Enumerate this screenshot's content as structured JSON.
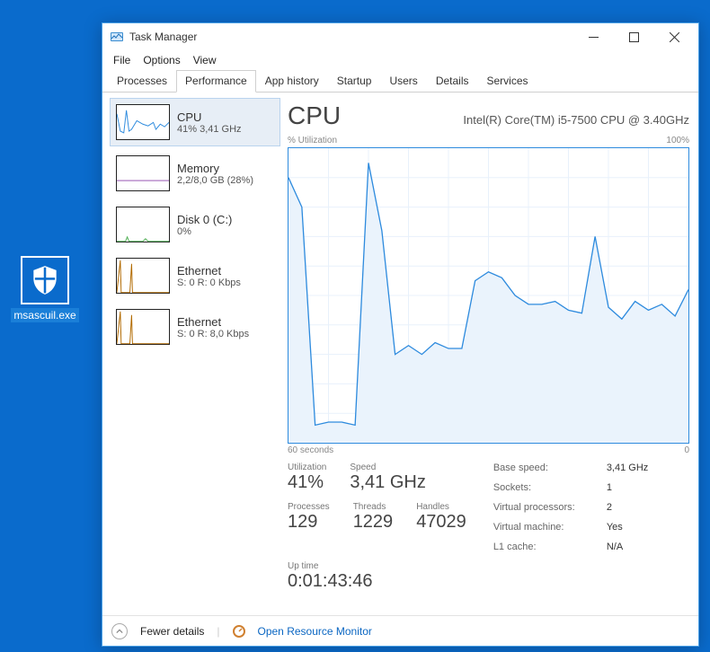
{
  "desktop_icon": {
    "label": "msascuil.exe"
  },
  "window": {
    "title": "Task Manager",
    "menus": [
      "File",
      "Options",
      "View"
    ],
    "tabs": [
      "Processes",
      "Performance",
      "App history",
      "Startup",
      "Users",
      "Details",
      "Services"
    ],
    "active_tab": 1
  },
  "sidebar": {
    "items": [
      {
        "title": "CPU",
        "sub": "41% 3,41 GHz",
        "thumb": "cpu",
        "selected": true
      },
      {
        "title": "Memory",
        "sub": "2,2/8,0 GB (28%)",
        "thumb": "mem"
      },
      {
        "title": "Disk 0 (C:)",
        "sub": "0%",
        "thumb": "disk"
      },
      {
        "title": "Ethernet",
        "sub": "S: 0 R: 0 Kbps",
        "thumb": "eth"
      },
      {
        "title": "Ethernet",
        "sub": "S: 0 R: 8,0 Kbps",
        "thumb": "eth"
      }
    ]
  },
  "main": {
    "heading": "CPU",
    "sub_heading": "Intel(R) Core(TM) i5-7500 CPU @ 3.40GHz",
    "chart_top_left": "% Utilization",
    "chart_top_right": "100%",
    "chart_bottom_left": "60 seconds",
    "chart_bottom_right": "0",
    "stats_left": {
      "utilization_label": "Utilization",
      "utilization_value": "41%",
      "speed_label": "Speed",
      "speed_value": "3,41 GHz",
      "processes_label": "Processes",
      "processes_value": "129",
      "threads_label": "Threads",
      "threads_value": "1229",
      "handles_label": "Handles",
      "handles_value": "47029"
    },
    "stats_right": [
      {
        "k": "Base speed:",
        "v": "3,41 GHz"
      },
      {
        "k": "Sockets:",
        "v": "1"
      },
      {
        "k": "Virtual processors:",
        "v": "2"
      },
      {
        "k": "Virtual machine:",
        "v": "Yes"
      },
      {
        "k": "L1 cache:",
        "v": "N/A"
      }
    ],
    "uptime_label": "Up time",
    "uptime_value": "0:01:43:46"
  },
  "footer": {
    "fewer": "Fewer details",
    "orm": "Open Resource Monitor"
  },
  "chart_data": {
    "type": "line",
    "title": "CPU % Utilization",
    "xlabel": "time (seconds ago)",
    "ylabel": "% Utilization",
    "xlim": [
      60,
      0
    ],
    "ylim": [
      0,
      100
    ],
    "series": [
      {
        "name": "CPU",
        "x": [
          60,
          58,
          56,
          54,
          52,
          50,
          48,
          46,
          44,
          42,
          40,
          38,
          36,
          34,
          32,
          30,
          28,
          26,
          24,
          22,
          20,
          18,
          16,
          14,
          12,
          10,
          8,
          6,
          4,
          2,
          0
        ],
        "values": [
          90,
          80,
          6,
          7,
          7,
          6,
          95,
          72,
          30,
          33,
          30,
          34,
          32,
          32,
          55,
          58,
          56,
          50,
          47,
          47,
          48,
          45,
          44,
          70,
          46,
          42,
          48,
          45,
          47,
          43,
          52
        ]
      }
    ]
  }
}
